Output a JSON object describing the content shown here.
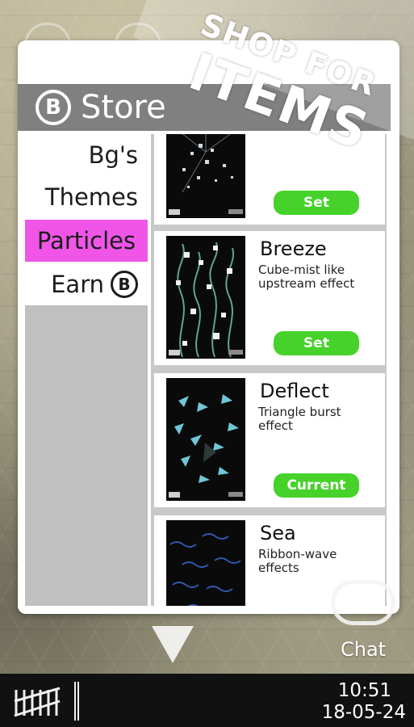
{
  "banner": {
    "line1": "SHOP FOR",
    "line2": "ITEMS"
  },
  "store": {
    "title": "Store",
    "title_icon": "bitcoin-icon",
    "sidebar": {
      "items": [
        {
          "label": "Bg's"
        },
        {
          "label": "Themes"
        },
        {
          "label": "Particles",
          "active": true
        },
        {
          "label": "Earn",
          "icon": "bitcoin-icon"
        }
      ]
    },
    "items": [
      {
        "name": "",
        "description": "",
        "button": "Set"
      },
      {
        "name": "Breeze",
        "description": "Cube-mist like upstream effect",
        "button": "Set"
      },
      {
        "name": "Deflect",
        "description": "Triangle burst effect",
        "button": "Current"
      },
      {
        "name": "Sea",
        "description": "Ribbon-wave effects",
        "button": ""
      }
    ]
  },
  "chat": {
    "label": "Chat"
  },
  "status": {
    "time": "10:51",
    "date": "18-05-24"
  },
  "colors": {
    "accent_active": "#f055e8",
    "button_green": "#46d22a",
    "header_gray": "#808080",
    "statusbar_bg": "#111111"
  }
}
